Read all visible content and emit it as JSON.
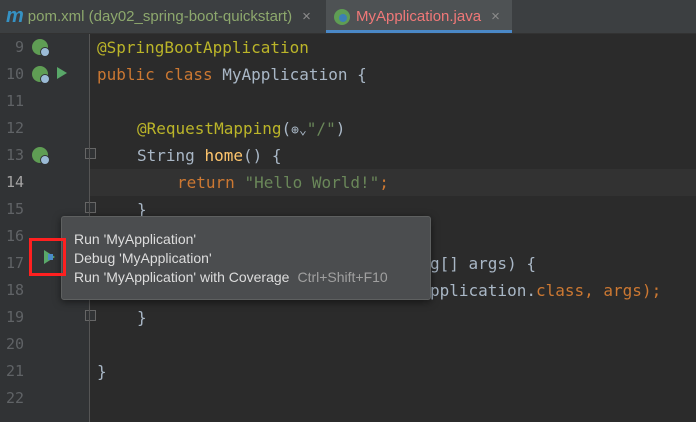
{
  "tabs": [
    {
      "label": "pom.xml (day02_spring-boot-quickstart)",
      "icon": "maven-icon",
      "close": "×"
    },
    {
      "label": "MyApplication.java",
      "icon": "spring-class-icon",
      "close": "×",
      "active": true
    }
  ],
  "lines": [
    {
      "num": "9"
    },
    {
      "num": "10"
    },
    {
      "num": "11"
    },
    {
      "num": "12"
    },
    {
      "num": "13"
    },
    {
      "num": "14"
    },
    {
      "num": "15"
    },
    {
      "num": "16"
    },
    {
      "num": "17"
    },
    {
      "num": "18"
    },
    {
      "num": "19"
    },
    {
      "num": "20"
    },
    {
      "num": "21"
    },
    {
      "num": "22"
    }
  ],
  "code": {
    "l9_anno": "@SpringBootApplication",
    "l10_kw": "public class ",
    "l10_rest": "MyApplication {",
    "l12_anno": "@RequestMapping",
    "l12_open": "(",
    "l12_str": "\"/\"",
    "l12_close": ")",
    "l13_type": "String ",
    "l13_fn": "home",
    "l13_rest": "() {",
    "l14_kw": "return ",
    "l14_str": "\"Hello World!\"",
    "l14_end": ";",
    "l15": "}",
    "l17_tail": "g[] args) {",
    "l18_tail": "pplication.",
    "l18_kw": "class",
    "l18_end": ", args);",
    "l19": "}",
    "l21": "}"
  },
  "popup": {
    "run": "Run 'MyApplication'",
    "debug": "Debug 'MyApplication'",
    "coverage": "Run 'MyApplication' with Coverage",
    "coverage_shortcut": "Ctrl+Shift+F10"
  },
  "colors": {
    "background": "#2b2b2b",
    "keyword": "#cc7832",
    "annotation": "#bbb529",
    "string": "#6a8759",
    "function": "#ffc66d",
    "highlight": "#ff2020"
  }
}
